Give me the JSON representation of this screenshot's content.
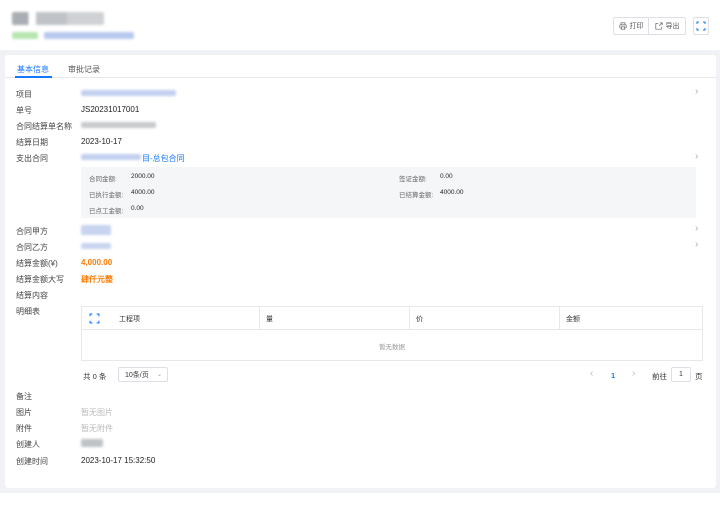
{
  "toolbar": {
    "print_label": "打印",
    "export_label": "导出",
    "fullscreen_label": "全屏"
  },
  "tabs": [
    {
      "label": "基本信息"
    },
    {
      "label": "审批记录"
    }
  ],
  "fields": {
    "project_label": "项目",
    "number_label": "单号",
    "number_value": "JS20231017001",
    "name_label": "合同结算单名称",
    "date_label": "结算日期",
    "date_value": "2023-10-17",
    "contract_label": "支出合同",
    "contract_value_suffix": "目-总包合同",
    "party_a_label": "合同甲方",
    "party_b_label": "合同乙方",
    "amount_label": "结算金额(¥)",
    "amount_value": "4,000.00",
    "amount_upper_label": "结算金额大写",
    "amount_upper_value": "肆仟元整",
    "content_label": "结算内容",
    "detail_label": "明细表",
    "remark_label": "备注",
    "image_label": "图片",
    "image_value": "暂无图片",
    "attachment_label": "附件",
    "attachment_value": "暂无附件",
    "creator_label": "创建人",
    "created_at_label": "创建时间",
    "created_at_value": "2023-10-17 15:32:50"
  },
  "contract_info": {
    "contract_amount_label": "合同金额:",
    "contract_amount_value": "2000.00",
    "visa_amount_label": "签证金额:",
    "visa_amount_value": "0.00",
    "executed_amount_label": "已执行金额:",
    "executed_amount_value": "4000.00",
    "settled_amount_label": "已结算金额:",
    "settled_amount_value": "4000.00",
    "labor_amount_label": "已点工金额:",
    "labor_amount_value": "0.00"
  },
  "detail_table": {
    "fullscreen_label": "全屏",
    "columns": [
      "工程项",
      "量",
      "价",
      "金额"
    ],
    "empty_text": "暂无数据"
  },
  "pagination": {
    "total": "共 0 条",
    "page_size": "10条/页",
    "prev": "‹",
    "current_page": "1",
    "next": "›",
    "goto_label": "前往",
    "goto_value": "1",
    "page_suffix": "页"
  },
  "colors": {
    "accent": "#1677ff",
    "amount": "#ff7a00"
  },
  "icons": [
    "printer-icon",
    "export-icon",
    "fullscreen-icon",
    "chevron-right-icon",
    "chevron-down-icon"
  ]
}
